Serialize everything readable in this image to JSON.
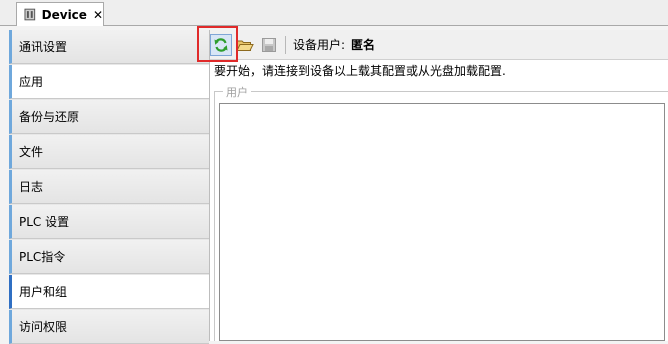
{
  "tab": {
    "title": "Device",
    "close": "✕"
  },
  "sidebar": {
    "items": [
      {
        "label": "通讯设置"
      },
      {
        "label": "应用"
      },
      {
        "label": "备份与还原"
      },
      {
        "label": "文件"
      },
      {
        "label": "日志"
      },
      {
        "label": "PLC 设置"
      },
      {
        "label": "PLC指令"
      },
      {
        "label": "用户和组"
      },
      {
        "label": "访问权限"
      }
    ],
    "active_item": "用户和组"
  },
  "toolbar": {
    "device_user_label": "设备用户:",
    "device_user_value": "匿名",
    "icons": [
      "refresh-icon",
      "open-folder-icon",
      "save-icon"
    ]
  },
  "main": {
    "hint": "要开始，请连接到设备以上载其配置或从光盘加载配置.",
    "group_legend": "用户"
  },
  "colors": {
    "accent": "#2f6fc3",
    "highlight_frame": "#e02a2a"
  }
}
